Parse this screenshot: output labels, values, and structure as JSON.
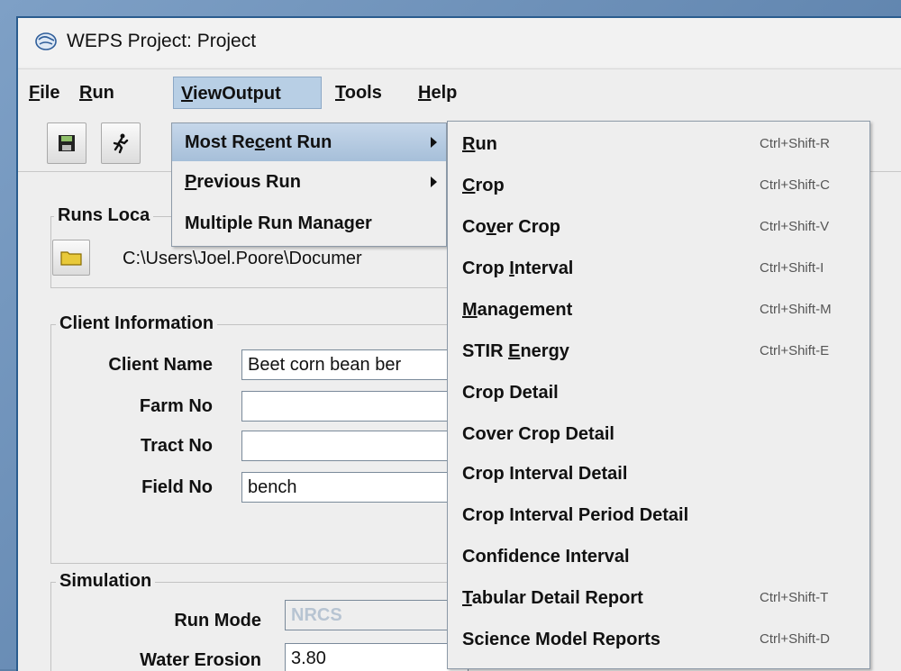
{
  "window": {
    "title": "WEPS Project: Project"
  },
  "menubar": {
    "items": [
      {
        "pre": "",
        "mn": "F",
        "post": "ile"
      },
      {
        "pre": "",
        "mn": "R",
        "post": "un"
      },
      {
        "pre": "",
        "mn": "V",
        "post": "iewOutput"
      },
      {
        "pre": "",
        "mn": "T",
        "post": "ools"
      },
      {
        "pre": "",
        "mn": "H",
        "post": "elp"
      }
    ]
  },
  "runs_location": {
    "title": "Runs Loca",
    "path": "C:\\Users\\Joel.Poore\\Documer"
  },
  "client_info": {
    "title": "Client Information",
    "client_name_label": "Client Name",
    "client_name_value": "Beet corn bean ber",
    "farm_no_label": "Farm No",
    "farm_no_value": "",
    "tract_no_label": "Tract No",
    "tract_no_value": "",
    "field_no_label": "Field No",
    "field_no_value": "bench"
  },
  "simulation": {
    "title": "Simulation",
    "run_mode_label": "Run Mode",
    "run_mode_value": "NRCS",
    "water_erosion_label": "Water Erosion",
    "water_erosion_value": "3.80"
  },
  "viewoutput_menu": {
    "items": [
      {
        "pre": "Most Re",
        "mn": "c",
        "post": "ent Run"
      },
      {
        "pre": "",
        "mn": "P",
        "post": "revious Run"
      },
      {
        "pre": "Multiple Run Manager",
        "mn": "",
        "post": ""
      }
    ]
  },
  "submenu": {
    "items": [
      {
        "pre": "",
        "mn": "R",
        "post": "un",
        "accel": "Ctrl+Shift-R"
      },
      {
        "pre": "",
        "mn": "C",
        "post": "rop",
        "accel": "Ctrl+Shift-C"
      },
      {
        "pre": "Co",
        "mn": "v",
        "post": "er Crop",
        "accel": "Ctrl+Shift-V"
      },
      {
        "pre": "Crop ",
        "mn": "I",
        "post": "nterval",
        "accel": "Ctrl+Shift-I"
      },
      {
        "pre": "",
        "mn": "M",
        "post": "anagement",
        "accel": "Ctrl+Shift-M"
      },
      {
        "pre": "STIR ",
        "mn": "E",
        "post": "nergy",
        "accel": "Ctrl+Shift-E"
      },
      {
        "pre": "Crop Detail",
        "mn": "",
        "post": "",
        "accel": ""
      },
      {
        "pre": "Cover Crop Detail",
        "mn": "",
        "post": "",
        "accel": ""
      },
      {
        "pre": "Crop Interval Detail",
        "mn": "",
        "post": "",
        "accel": ""
      },
      {
        "pre": "Crop Interval Period Detail",
        "mn": "",
        "post": "",
        "accel": ""
      },
      {
        "pre": "Confidence Interval",
        "mn": "",
        "post": "",
        "accel": ""
      },
      {
        "pre": "",
        "mn": "T",
        "post": "abular Detail Report",
        "accel": "Ctrl+Shift-T"
      },
      {
        "pre": "Science Model Reports",
        "mn": "",
        "post": "",
        "accel": "Ctrl+Shift-D"
      }
    ]
  }
}
